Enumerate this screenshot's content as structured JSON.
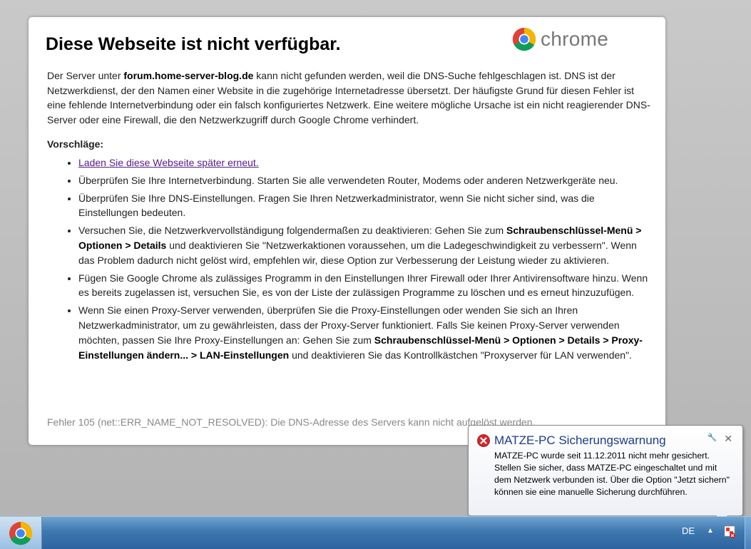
{
  "page": {
    "title": "Diese Webseite ist nicht verfügbar.",
    "logo_text": "chrome",
    "desc": {
      "p1": "Der Server unter ",
      "host": "forum.home-server-blog.de",
      "p2": " kann nicht gefunden werden, weil die DNS-Suche fehlgeschlagen ist. DNS ist der Netzwerkdienst, der den Namen einer Website in die zugehörige Internetadresse übersetzt. Der häufigste Grund für diesen Fehler ist eine fehlende Internetverbindung oder ein falsch konfiguriertes Netzwerk. Eine weitere mögliche Ursache ist ein nicht reagierender DNS-Server oder eine Firewall, die den Netzwerkzugriff durch Google Chrome verhindert."
    },
    "suggestions_title": "Vorschläge:",
    "suggestions": {
      "reload_link": "Laden Sie diese Webseite später erneut.",
      "s2": "Überprüfen Sie Ihre Internetverbindung. Starten Sie alle verwendeten Router, Modems oder anderen Netzwerkgeräte neu.",
      "s3": "Überprüfen Sie Ihre DNS-Einstellungen. Fragen Sie Ihren Netzwerkadministrator, wenn Sie nicht sicher sind, was die Einstellungen bedeuten.",
      "s4a": "Versuchen Sie, die Netzwerkvervollständigung folgendermaßen zu deaktivieren: Gehen Sie zum ",
      "s4b": "Schraubenschlüssel-Menü > Optionen > Details",
      "s4c": " und deaktivieren Sie \"Netzwerkaktionen voraussehen, um die Ladegeschwindigkeit zu verbessern\". Wenn das Problem dadurch nicht gelöst wird, empfehlen wir, diese Option zur Verbesserung der Leistung wieder zu aktivieren.",
      "s5": "Fügen Sie Google Chrome als zulässiges Programm in den Einstellungen Ihrer Firewall oder Ihrer Antivirensoftware hinzu. Wenn es bereits zugelassen ist, versuchen Sie, es von der Liste der zulässigen Programme zu löschen und es erneut hinzuzufügen.",
      "s6a": "Wenn Sie einen Proxy-Server verwenden, überprüfen Sie die Proxy-Einstellungen oder wenden Sie sich an Ihren Netzwerkadministrator, um zu gewährleisten, dass der Proxy-Server funktioniert. Falls Sie keinen Proxy-Server verwenden möchten, passen Sie Ihre Proxy-Einstellungen an: Gehen Sie zum ",
      "s6b": "Schraubenschlüssel-Menü > Optionen > Details > Proxy-Einstellungen ändern... > LAN-Einstellungen",
      "s6c": " und deaktivieren Sie das Kontrollkästchen \"Proxyserver für LAN verwenden\"."
    },
    "error_code": "Fehler 105 (net::ERR_NAME_NOT_RESOLVED): Die DNS-Adresse des Servers kann nicht aufgelöst werden."
  },
  "notification": {
    "title": "MATZE-PC Sicherungswarnung",
    "body": "MATZE-PC wurde seit 11.12.2011 nicht mehr gesichert. Stellen Sie sicher, dass MATZE-PC eingeschaltet und mit dem Netzwerk verbunden ist. Über die Option \"Jetzt sichern\" können sie eine manuelle Sicherung durchführen.",
    "close_glyph": "✕",
    "options_glyph": "🔧"
  },
  "taskbar": {
    "language": "DE",
    "tray_arrow": "▲"
  },
  "colors": {
    "link": "#551a8b",
    "notification_title": "#1b3d8a",
    "error_icon": "#d4252a",
    "taskbar": "#3e78b0"
  }
}
